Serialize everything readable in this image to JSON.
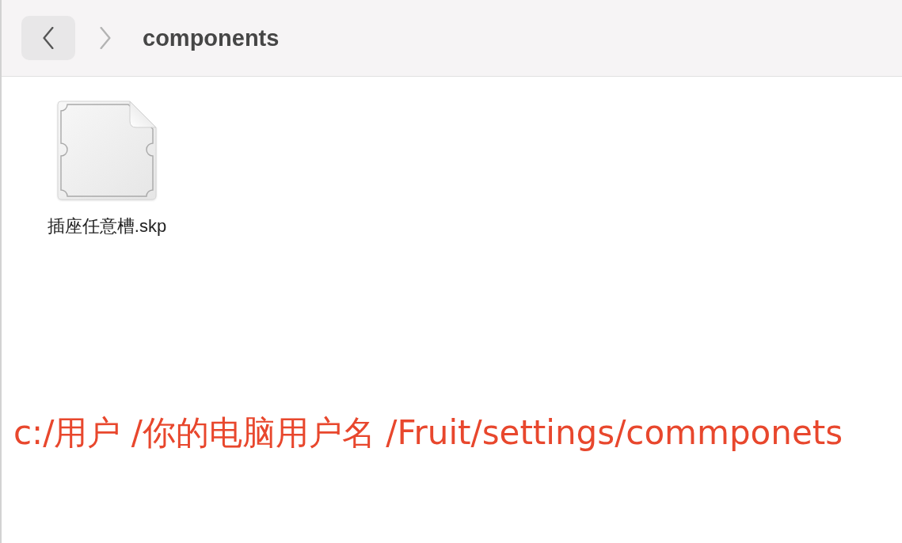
{
  "toolbar": {
    "back_button": {
      "disabled": false
    },
    "forward_button": {
      "disabled": true
    },
    "title": "components"
  },
  "files": [
    {
      "name": "插座任意槽.skp"
    }
  ],
  "annotation": "c:/用户 /你的电脑用户名 /Fruit/settings/commponets"
}
